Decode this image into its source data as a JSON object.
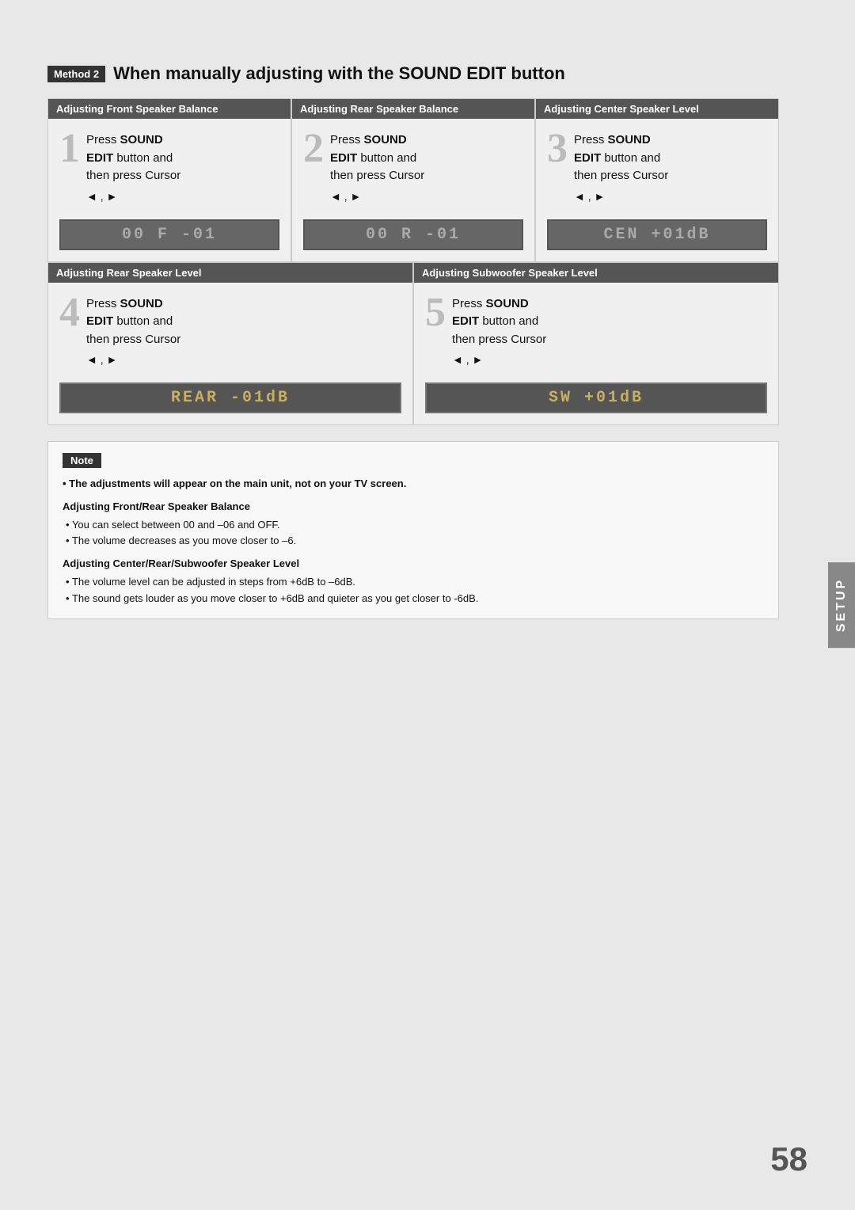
{
  "page": {
    "page_number": "58",
    "setup_tab": "SETUP"
  },
  "method": {
    "badge": "Method 2",
    "title": "When manually adjusting with the SOUND EDIT button"
  },
  "top_row": [
    {
      "header": "Adjusting Front Speaker Balance",
      "step_number": "1",
      "line1": "Press ",
      "bold1": "SOUND",
      "line2": "EDIT",
      "line2_rest": " button and",
      "line3": "then press Cursor",
      "cursor": "◄ , ►",
      "lcd": "00 F -01",
      "lcd_highlighted": false
    },
    {
      "header": "Adjusting Rear Speaker Balance",
      "step_number": "2",
      "line1": "Press ",
      "bold1": "SOUND",
      "line2": "EDIT",
      "line2_rest": " button and",
      "line3": "then press Cursor",
      "cursor": "◄ , ►",
      "lcd": "00 R -01",
      "lcd_highlighted": false
    },
    {
      "header": "Adjusting Center Speaker Level",
      "step_number": "3",
      "line1": "Press ",
      "bold1": "SOUND",
      "line2": "EDIT",
      "line2_rest": " button and",
      "line3": "then press Cursor",
      "cursor": "◄ , ►",
      "lcd": "CEN +01dB",
      "lcd_highlighted": false
    }
  ],
  "bottom_row": [
    {
      "header": "Adjusting Rear Speaker Level",
      "step_number": "4",
      "line1": "Press ",
      "bold1": "SOUND",
      "line2": "EDIT",
      "line2_rest": " button and",
      "line3": "then press Cursor",
      "cursor": "◄ , ►",
      "lcd": "REAR -01dB",
      "lcd_highlighted": true
    },
    {
      "header": "Adjusting Subwoofer Speaker Level",
      "step_number": "5",
      "line1": "Press ",
      "bold1": "SOUND",
      "line2": "EDIT",
      "line2_rest": " button and",
      "line3": "then press Cursor",
      "cursor": "◄ , ►",
      "lcd": "SW  +01dB",
      "lcd_highlighted": true
    }
  ],
  "note": {
    "badge": "Note",
    "main_note": "The adjustments will appear on the main unit, not on your TV screen.",
    "subsections": [
      {
        "title": "Adjusting Front/Rear Speaker Balance",
        "items": [
          "You can select between 00 and –06 and OFF.",
          "The volume decreases as you move closer to –6."
        ]
      },
      {
        "title": "Adjusting Center/Rear/Subwoofer Speaker Level",
        "items": [
          "The volume level can be adjusted in steps from +6dB to –6dB.",
          "The sound gets louder as you move closer to +6dB and quieter as you get closer to -6dB."
        ]
      }
    ]
  }
}
